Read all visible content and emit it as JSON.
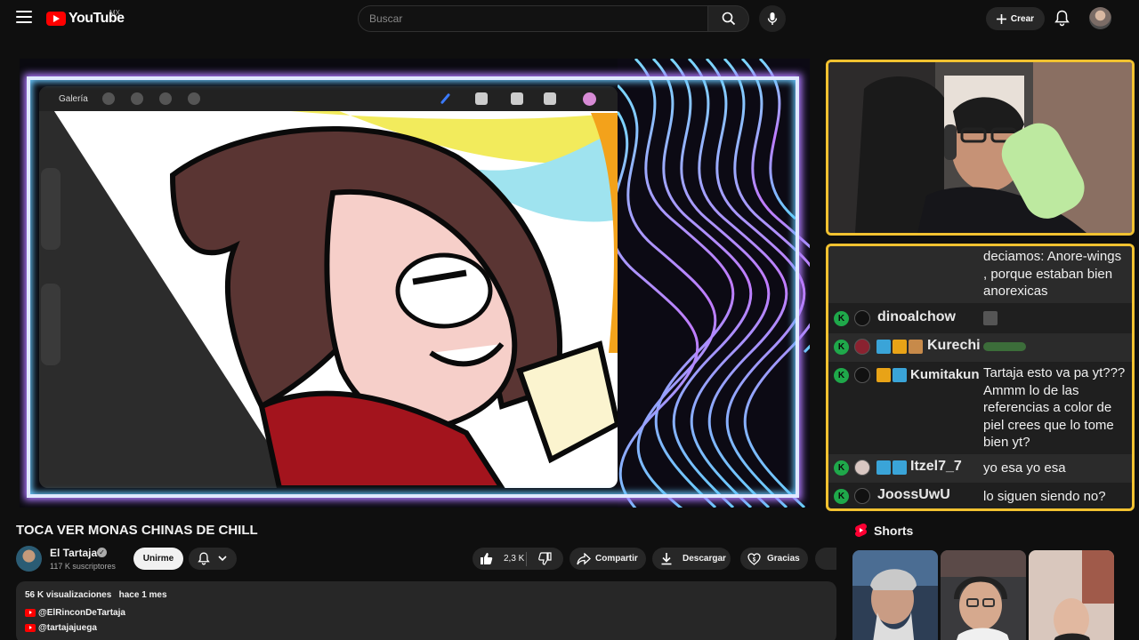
{
  "header": {
    "logo_text": "YouTube",
    "country_code": "MX",
    "search_placeholder": "Buscar",
    "create_label": "Crear"
  },
  "stream_overlay": {
    "procreate_gallery_label": "Galería"
  },
  "chat": {
    "messages": [
      {
        "user": "",
        "text": "deciamos: Anore-wings , porque estaban bien anorexicas"
      },
      {
        "user": "dinoalchow",
        "text": ""
      },
      {
        "user": "Kurechi",
        "text": ""
      },
      {
        "user": "Kumitakun",
        "text": "Tartaja esto va pa yt??? Ammm lo de las referencias a color de piel crees que lo tome bien yt?"
      },
      {
        "user": "Itzel7_7",
        "text": "yo esa yo esa"
      },
      {
        "user": "JoossUwU",
        "text": "lo siguen siendo no?"
      }
    ],
    "badge_letter": "K"
  },
  "video": {
    "title": "TOCA VER MONAS CHINAS DE CHILL",
    "channel_name": "El Tartaja",
    "subscribers": "117 K suscriptores",
    "join_label": "Unirme",
    "likes": "2,3 K",
    "share_label": "Compartir",
    "download_label": "Descargar",
    "thanks_label": "Gracias"
  },
  "description": {
    "views": "56 K visualizaciones",
    "date": "hace 1 mes",
    "links": [
      "@ElRinconDeTartaja",
      "@tartajajuega"
    ]
  },
  "shorts": {
    "title": "Shorts"
  },
  "colors": {
    "accent_red": "#ff0000",
    "frame_yellow": "#f2c230",
    "chat_badge_green": "#1fa84a"
  }
}
